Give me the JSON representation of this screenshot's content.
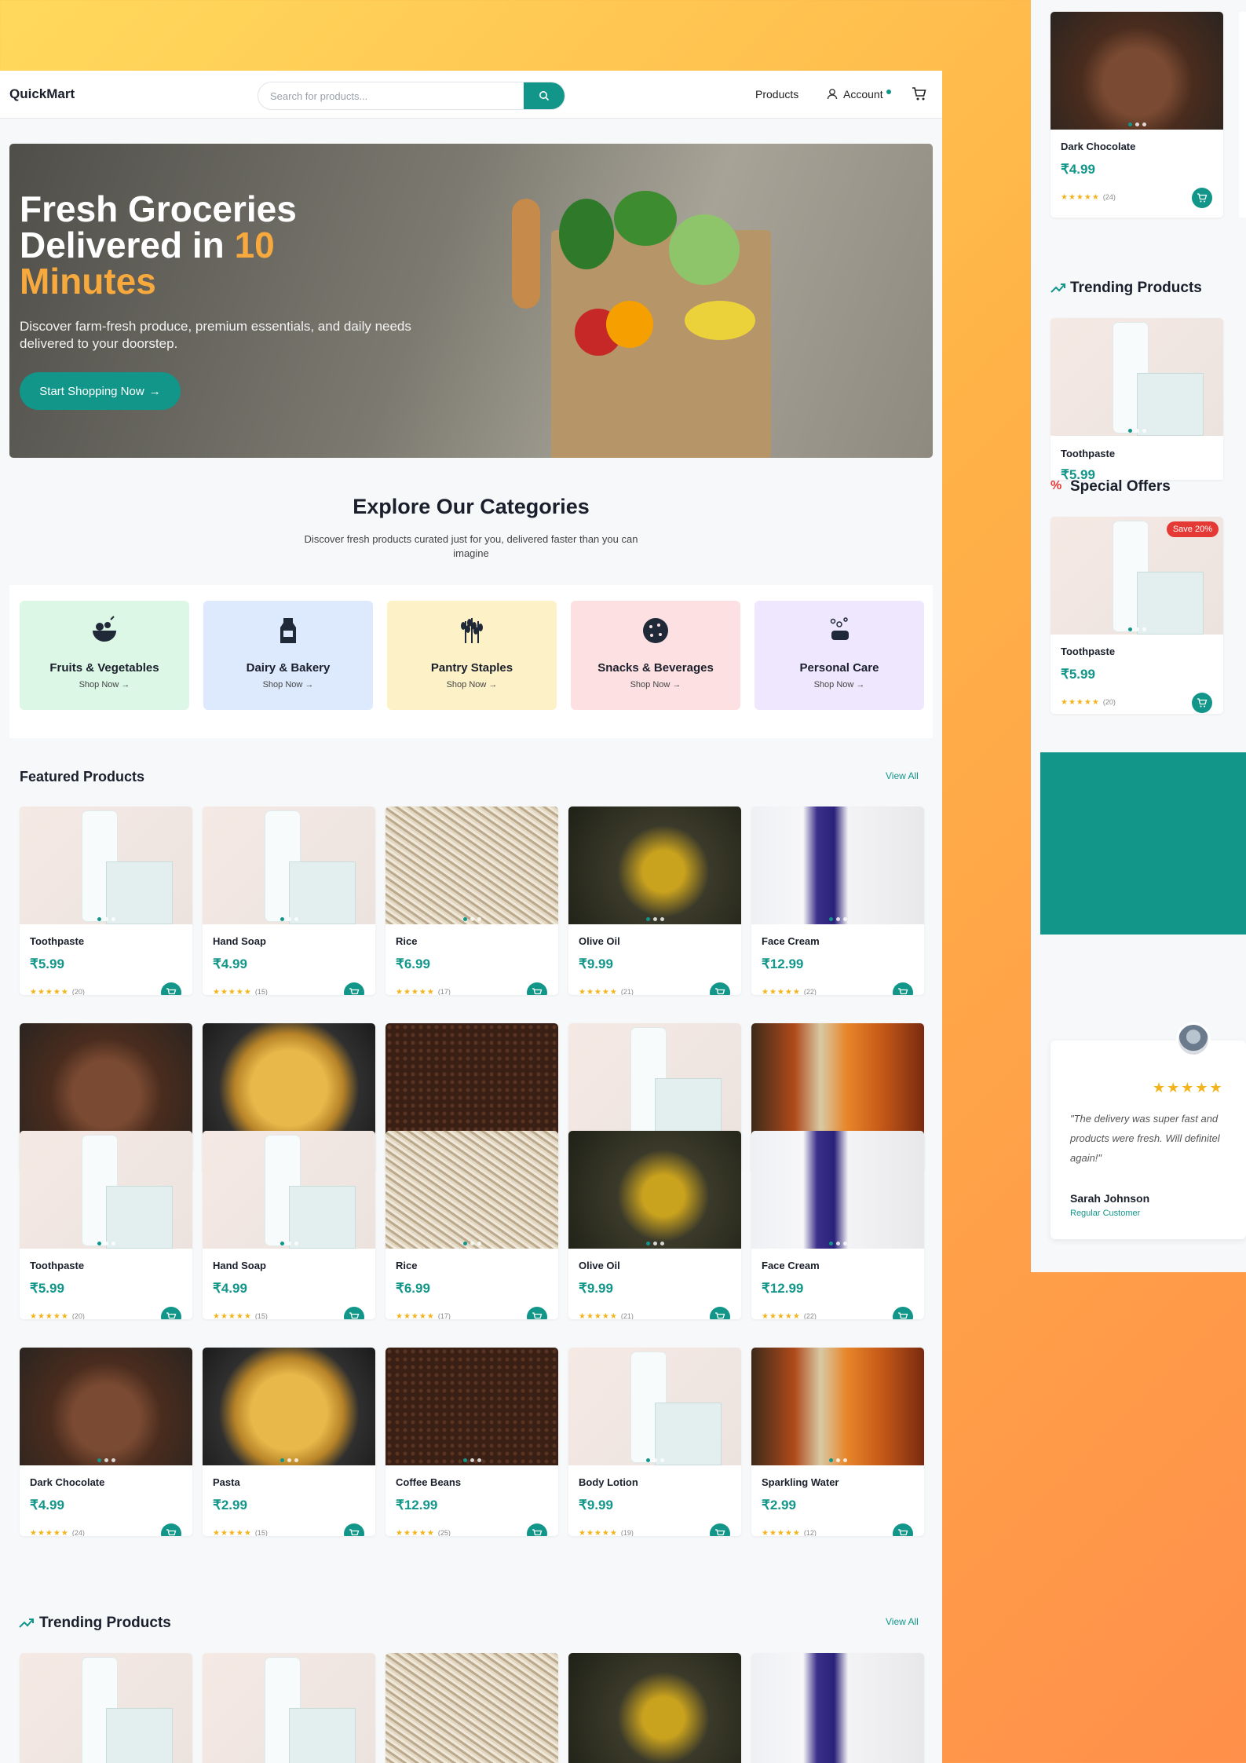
{
  "nav": {
    "logo": "QuickMart",
    "search_placeholder": "Search for products...",
    "products": "Products",
    "account": "Account"
  },
  "hero": {
    "title_line1": "Fresh Groceries",
    "title_line2a": "Delivered in ",
    "title_line2b": "10",
    "title_line3": "Minutes",
    "subtitle": "Discover farm-fresh produce, premium essentials, and daily needs delivered to your doorstep.",
    "cta": "Start Shopping Now"
  },
  "categories": {
    "title": "Explore Our Categories",
    "subtitle_l1": "Discover fresh products curated just for you, delivered faster than you can",
    "subtitle_l2": "imagine",
    "items": [
      {
        "name": "Fruits & Vegetables",
        "link": "Shop Now →",
        "color": "#dcf7e5"
      },
      {
        "name": "Dairy & Bakery",
        "link": "Shop Now →",
        "color": "#dde9fd"
      },
      {
        "name": "Pantry Staples",
        "link": "Shop Now →",
        "color": "#fdf2c7"
      },
      {
        "name": "Snacks & Beverages",
        "link": "Shop Now →",
        "color": "#fde1e2"
      },
      {
        "name": "Personal Care",
        "link": "Shop Now →",
        "color": "#efe7fd"
      }
    ]
  },
  "featured": {
    "title": "Featured Products",
    "view_all": "View All"
  },
  "trending": {
    "title": "Trending Products",
    "view_all": "View All"
  },
  "products": [
    {
      "name": "Toothpaste",
      "price": "₹5.99",
      "stars": "★★★★★",
      "count": "(20)",
      "img": "tp"
    },
    {
      "name": "Hand Soap",
      "price": "₹4.99",
      "stars": "★★★★★",
      "count": "(15)",
      "img": "tp"
    },
    {
      "name": "Rice",
      "price": "₹6.99",
      "stars": "★★★★★",
      "count": "(17)",
      "img": "rice"
    },
    {
      "name": "Olive Oil",
      "price": "₹9.99",
      "stars": "★★★★★",
      "count": "(21)",
      "img": "oil"
    },
    {
      "name": "Face Cream",
      "price": "₹12.99",
      "stars": "★★★★★",
      "count": "(22)",
      "img": "cream"
    },
    {
      "name": "Dark Chocolate",
      "price": "₹4.99",
      "stars": "★★★★★",
      "count": "(24)",
      "img": "choc"
    },
    {
      "name": "Pasta",
      "price": "₹2.99",
      "stars": "★★★★★",
      "count": "(15)",
      "img": "pasta"
    },
    {
      "name": "Coffee Beans",
      "price": "₹12.99",
      "stars": "★★★★★",
      "count": "(25)",
      "img": "coffee"
    },
    {
      "name": "Body Lotion",
      "price": "₹9.99",
      "stars": "★★★★★",
      "count": "(19)",
      "img": "tp"
    },
    {
      "name": "Sparkling Water",
      "price": "₹2.99",
      "stars": "★★★★★",
      "count": "(12)",
      "img": "soda"
    }
  ],
  "side": {
    "top_card": {
      "name": "Dark Chocolate",
      "price": "₹4.99",
      "stars": "★★★★★",
      "count": "(24)"
    },
    "trending_title": "Trending Products",
    "trending_card": {
      "name": "Toothpaste",
      "price": "₹5.99"
    },
    "offers_title": "Special Offers",
    "offer_card": {
      "badge": "Save 20%",
      "name": "Toothpaste",
      "price": "₹5.99",
      "stars": "★★★★★",
      "count": "(20)"
    },
    "review": {
      "stars": "★★★★★",
      "text_l1": "\"The delivery was super fast and",
      "text_l2": "products were fresh. Will definitel",
      "text_l3": "again!\"",
      "name": "Sarah Johnson",
      "role": "Regular Customer"
    }
  },
  "colors": {
    "accent": "#12968a",
    "highlight": "#f7a93d",
    "badge": "#e53935"
  }
}
